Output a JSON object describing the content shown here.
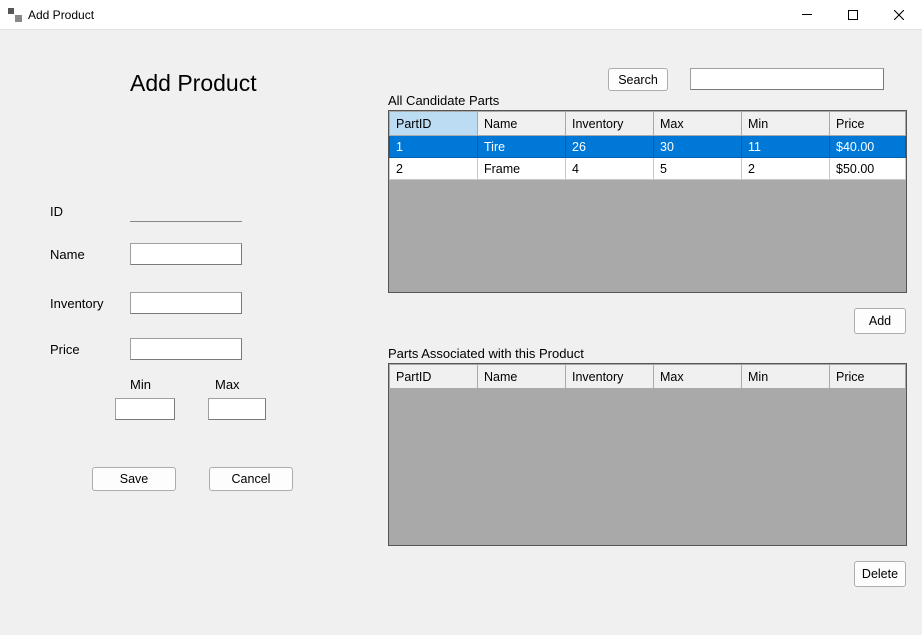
{
  "window": {
    "title": "Add Product"
  },
  "page": {
    "heading": "Add Product"
  },
  "form": {
    "id_label": "ID",
    "id_value": "",
    "name_label": "Name",
    "name_value": "",
    "inventory_label": "Inventory",
    "inventory_value": "",
    "price_label": "Price",
    "price_value": "",
    "min_label": "Min",
    "min_value": "",
    "max_label": "Max",
    "max_value": ""
  },
  "buttons": {
    "save": "Save",
    "cancel": "Cancel",
    "search": "Search",
    "add": "Add",
    "delete": "Delete"
  },
  "search": {
    "value": ""
  },
  "candidate_grid": {
    "label": "All Candidate Parts",
    "columns": [
      "PartID",
      "Name",
      "Inventory",
      "Max",
      "Min",
      "Price"
    ],
    "rows": [
      {
        "partid": "1",
        "name": "Tire",
        "inventory": "26",
        "max": "30",
        "min": "11",
        "price": "$40.00",
        "selected": true
      },
      {
        "partid": "2",
        "name": "Frame",
        "inventory": "4",
        "max": "5",
        "min": "2",
        "price": "$50.00",
        "selected": false
      }
    ]
  },
  "associated_grid": {
    "label": "Parts Associated with this Product",
    "columns": [
      "PartID",
      "Name",
      "Inventory",
      "Max",
      "Min",
      "Price"
    ],
    "rows": []
  }
}
